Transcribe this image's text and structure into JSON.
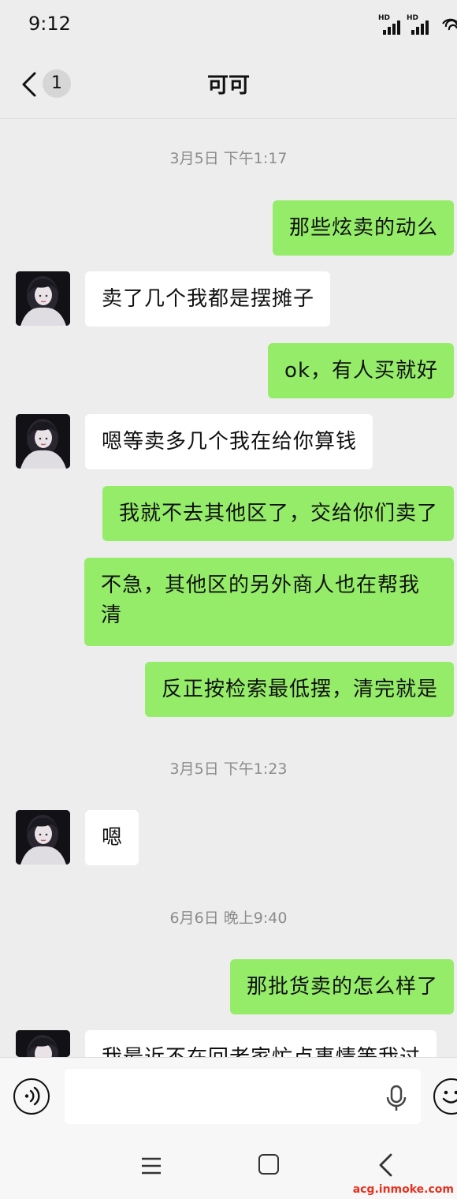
{
  "status_bar": {
    "time": "9:12",
    "signal_label_1": "HD",
    "signal_label_2": "HD"
  },
  "header": {
    "title": "可可",
    "unread_count": "1"
  },
  "messages": [
    {
      "type": "timestamp",
      "text": "3月5日 下午1:17"
    },
    {
      "type": "out",
      "text": "那些炫卖的动么"
    },
    {
      "type": "in",
      "text": "卖了几个我都是摆摊子"
    },
    {
      "type": "out",
      "text": "ok，有人买就好"
    },
    {
      "type": "in",
      "text": "嗯等卖多几个我在给你算钱"
    },
    {
      "type": "out",
      "text": "我就不去其他区了，交给你们卖了"
    },
    {
      "type": "out",
      "text": "不急，其他区的另外商人也在帮我清"
    },
    {
      "type": "out",
      "text": "反正按检索最低摆，清完就是"
    },
    {
      "type": "timestamp",
      "text": "3月5日 下午1:23"
    },
    {
      "type": "in",
      "text": "嗯"
    },
    {
      "type": "timestamp",
      "text": "6月6日 晚上9:40"
    },
    {
      "type": "out",
      "text": "那批货卖的怎么样了"
    },
    {
      "type": "in",
      "text": "我最近不在回老家忙点事情等我过"
    }
  ],
  "input": {
    "placeholder": "",
    "value": ""
  },
  "icons": {
    "back": "back-arrow-icon",
    "voice": "voice-icon",
    "mic": "microphone-icon",
    "emoji": "emoji-icon",
    "nav_menu": "menu-icon",
    "nav_home": "home-icon",
    "nav_back": "nav-back-icon",
    "wifi": "wifi-icon",
    "signal": "signal-icon"
  },
  "colors": {
    "outgoing_bubble": "#95ec69",
    "incoming_bubble": "#ffffff",
    "background": "#ededed",
    "timestamp": "#8c8c8c"
  },
  "watermark": "acg.inmoke.com"
}
